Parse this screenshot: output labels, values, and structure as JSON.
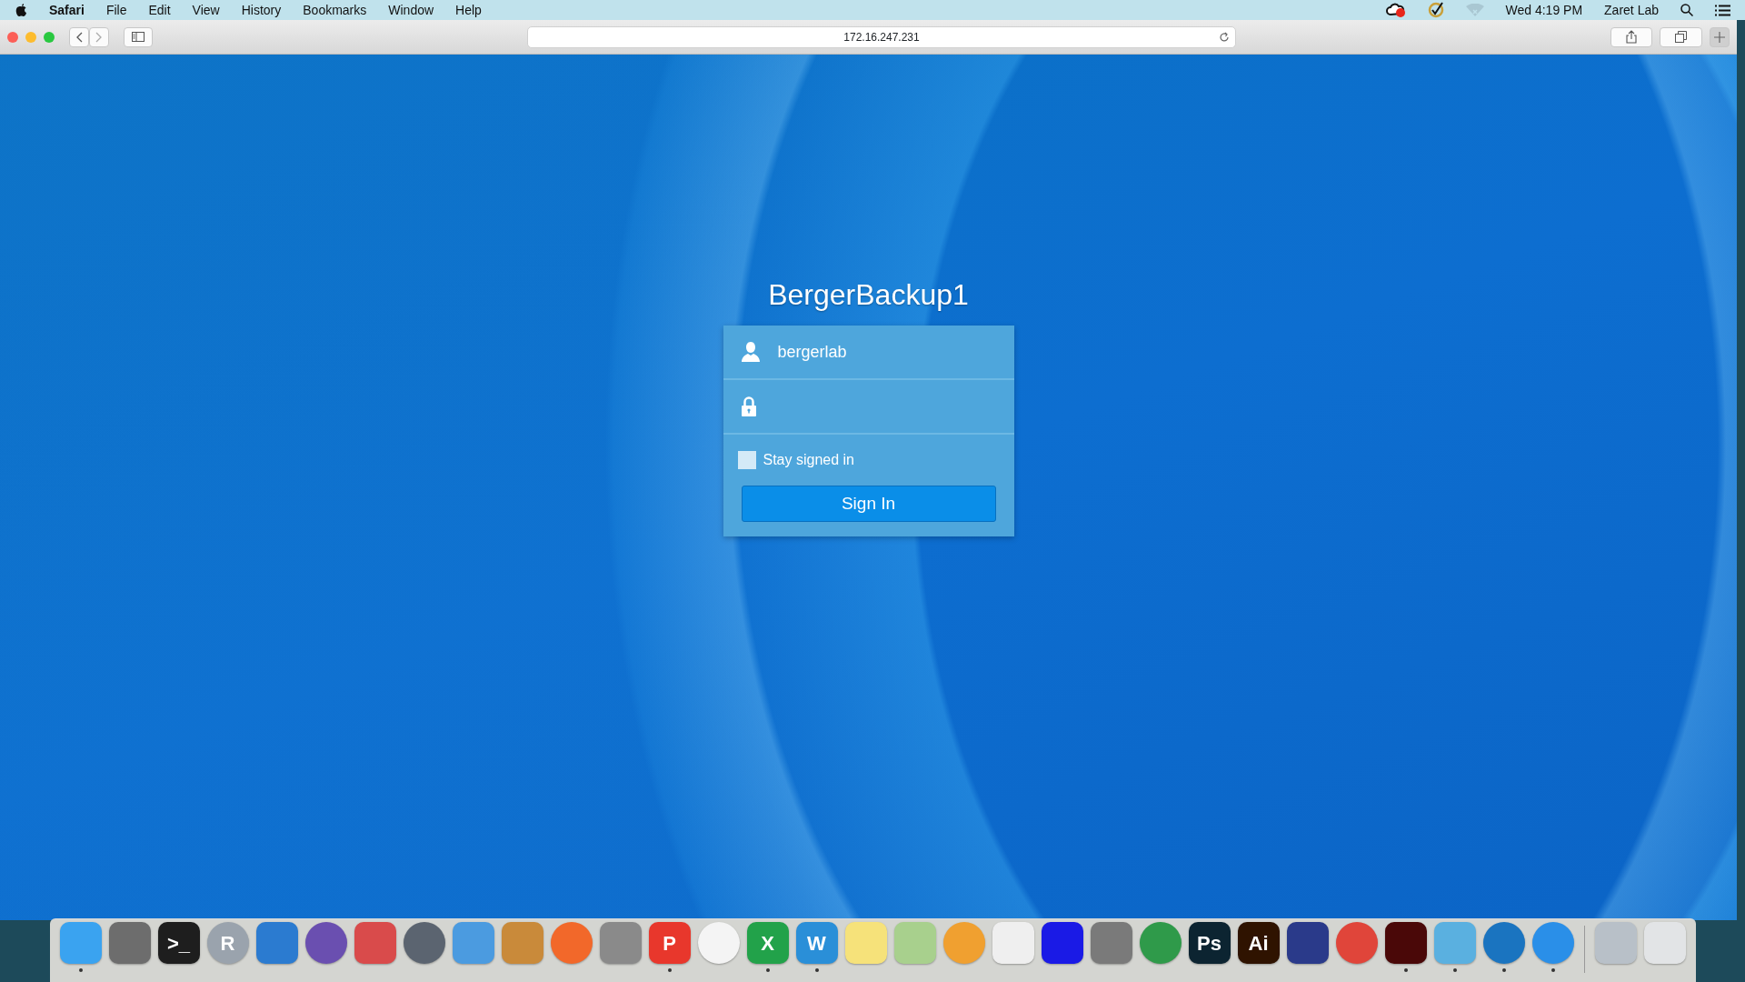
{
  "menu_bar": {
    "app": "Safari",
    "items": [
      "File",
      "Edit",
      "View",
      "History",
      "Bookmarks",
      "Window",
      "Help"
    ],
    "clock": "Wed 4:19 PM",
    "user": "Zaret Lab"
  },
  "browser": {
    "address": "172.16.247.231"
  },
  "login": {
    "title": "BergerBackup1",
    "username": "bergerlab",
    "stay_signed_in": {
      "label": "Stay signed in",
      "checked": false
    },
    "button": "Sign In"
  },
  "dock": {
    "apps": [
      {
        "kind": "square",
        "color": "#3aa3f0",
        "running": true
      },
      {
        "kind": "square",
        "color": "#6d6d6d",
        "running": false
      },
      {
        "kind": "square",
        "color": "#1e1e1e",
        "glyph": ">_",
        "running": false
      },
      {
        "kind": "circle",
        "color": "#9aa3ad",
        "glyph": "R",
        "running": false
      },
      {
        "kind": "square",
        "color": "#2b7bd0",
        "running": false
      },
      {
        "kind": "circle",
        "color": "#6a4fb0",
        "running": false
      },
      {
        "kind": "square",
        "color": "#d94b4b",
        "running": false
      },
      {
        "kind": "circle",
        "color": "#5b6470",
        "running": false
      },
      {
        "kind": "square",
        "color": "#4b9be0",
        "running": false
      },
      {
        "kind": "square",
        "color": "#c98a3a",
        "running": false
      },
      {
        "kind": "circle",
        "color": "#f2682a",
        "running": false
      },
      {
        "kind": "square",
        "color": "#8a8a8a",
        "running": false
      },
      {
        "kind": "square",
        "color": "#e8372c",
        "glyph": "P",
        "running": true
      },
      {
        "kind": "circle",
        "color": "#f4f4f4",
        "running": false
      },
      {
        "kind": "square",
        "color": "#22a24a",
        "glyph": "X",
        "running": true
      },
      {
        "kind": "square",
        "color": "#2a8fd8",
        "glyph": "W",
        "running": true
      },
      {
        "kind": "square",
        "color": "#f6e27a",
        "running": false
      },
      {
        "kind": "square",
        "color": "#a8d08d",
        "running": false
      },
      {
        "kind": "circle",
        "color": "#f0a030",
        "running": false
      },
      {
        "kind": "square",
        "color": "#efefef",
        "running": false
      },
      {
        "kind": "square",
        "color": "#1a1ae6",
        "running": false
      },
      {
        "kind": "square",
        "color": "#7a7a7a",
        "running": false
      },
      {
        "kind": "circle",
        "color": "#2f9a4a",
        "running": false
      },
      {
        "kind": "square",
        "color": "#0c2431",
        "glyph": "Ps",
        "running": false
      },
      {
        "kind": "square",
        "color": "#2f1300",
        "glyph": "Ai",
        "running": false
      },
      {
        "kind": "square",
        "color": "#2a3a8a",
        "running": false
      },
      {
        "kind": "circle",
        "color": "#e0453a",
        "running": false
      },
      {
        "kind": "square",
        "color": "#4a0808",
        "running": true
      },
      {
        "kind": "square",
        "color": "#5ab0e0",
        "running": true
      },
      {
        "kind": "circle",
        "color": "#1a74c0",
        "running": true
      },
      {
        "kind": "circle",
        "color": "#2a8fe8",
        "running": true
      }
    ],
    "documents": [
      {
        "kind": "square",
        "color": "#b8c0c8",
        "running": false
      },
      {
        "kind": "square",
        "color": "#e2e4e6",
        "running": false
      }
    ]
  }
}
